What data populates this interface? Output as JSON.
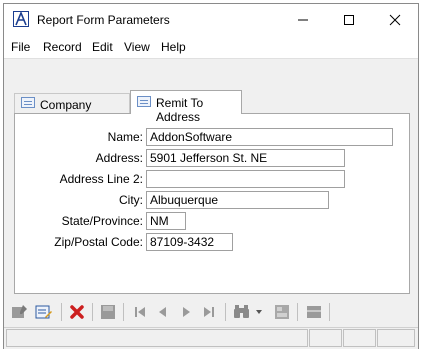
{
  "window": {
    "title": "Report Form Parameters",
    "minimize_glyph": "—",
    "maximize_glyph": "☐",
    "close_glyph": "✕"
  },
  "menu": {
    "items": [
      "File",
      "Record",
      "Edit",
      "View",
      "Help"
    ]
  },
  "tabs": [
    {
      "label": "Company Address",
      "icon": "form-icon",
      "active": false
    },
    {
      "label": "Remit To Address",
      "icon": "form-icon",
      "active": true
    }
  ],
  "form": {
    "fields": [
      {
        "label": "Name:",
        "value": "AddonSoftware"
      },
      {
        "label": "Address:",
        "value": "5901 Jefferson St. NE"
      },
      {
        "label": "Address Line 2:",
        "value": ""
      },
      {
        "label": "City:",
        "value": "Albuquerque"
      },
      {
        "label": "State/Province:",
        "value": "NM"
      },
      {
        "label": "Zip/Postal Code:",
        "value": "87109-3432"
      }
    ]
  },
  "toolbar": {
    "buttons": [
      "new-record-icon",
      "edit-record-icon",
      "delete-icon",
      "save-icon",
      "first-record-icon",
      "previous-record-icon",
      "next-record-icon",
      "last-record-icon",
      "find-icon",
      "find-dropdown-icon",
      "lookup-icon",
      "print-icon"
    ],
    "colors": {
      "delete": "#cc1f1f",
      "disabled": "#9a9a9a",
      "accent": "#2c5aa0"
    }
  }
}
